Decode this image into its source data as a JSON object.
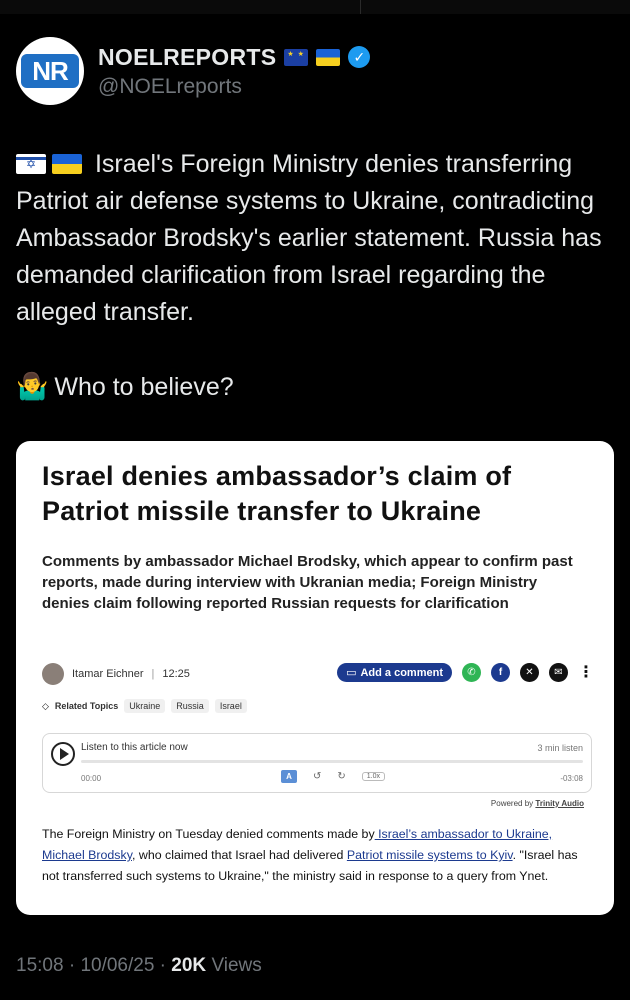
{
  "user": {
    "display_name": "NOELREPORTS",
    "handle": "@NOELreports",
    "avatar_text": "NR"
  },
  "tweet": {
    "line1": "Israel's Foreign Ministry denies transferring Patriot air defense systems to Ukraine, contradicting Ambassador Brodsky's earlier statement. Russia has demanded clarification from Israel regarding the alleged transfer.",
    "line2": "Who to believe?",
    "emoji_shrug": "🤷‍♂️"
  },
  "card": {
    "headline": "Israel denies ambassador’s claim of Patriot missile transfer to Ukraine",
    "subheadline": "Comments by ambassador Michael Brodsky, which appear to confirm past reports, made during interview with Ukranian media; Foreign Ministry denies claim following reported Russian requests for clarification",
    "author": "Itamar Eichner",
    "time": "12:25",
    "add_comment": "Add a comment",
    "related_label": "Related Topics",
    "topics": [
      "Ukraine",
      "Russia",
      "Israel"
    ],
    "player": {
      "listen": "Listen to this article now",
      "length": "3 min listen",
      "start": "00:00",
      "end": "-03:08",
      "rate": "1.0x",
      "translate": "A"
    },
    "powered_prefix": "Powered by",
    "powered_brand": "Trinity Audio",
    "body": {
      "t1": "The Foreign Ministry on Tuesday denied comments made by",
      "link1": " Israel’s ambassador to Ukraine, Michael Brodsky",
      "t2": ", who claimed that Israel had delivered ",
      "link2": "Patriot missile systems to Kyiv",
      "t3": ". \"Israel has not transferred such systems to Ukraine,\" the ministry said in response to a query from Ynet."
    }
  },
  "meta": {
    "time": "15:08",
    "date": "10/06/25",
    "views_count": "20K",
    "views_label": "Views"
  }
}
